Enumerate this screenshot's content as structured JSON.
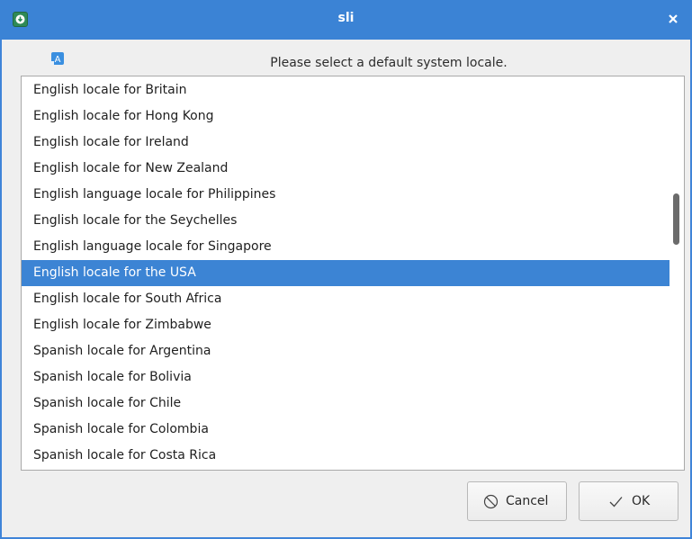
{
  "window": {
    "title": "sli"
  },
  "header": {
    "prompt": "Please select a default system locale.",
    "icon": "locale-language-icon"
  },
  "locales": [
    "English locale for Britain",
    "English locale for Hong Kong",
    "English locale for Ireland",
    "English locale for New Zealand",
    "English language locale for Philippines",
    "English locale for the Seychelles",
    "English language locale for Singapore",
    "English locale for the USA",
    "English locale for South Africa",
    "English locale for Zimbabwe",
    "Spanish locale for Argentina",
    "Spanish locale for Bolivia",
    "Spanish locale for Chile",
    "Spanish locale for Colombia",
    "Spanish locale for Costa Rica"
  ],
  "selected_locale": "English locale for the USA",
  "buttons": {
    "cancel": "Cancel",
    "ok": "OK"
  },
  "colors": {
    "titlebar": "#3b83d5",
    "selection": "#3c84d4"
  }
}
